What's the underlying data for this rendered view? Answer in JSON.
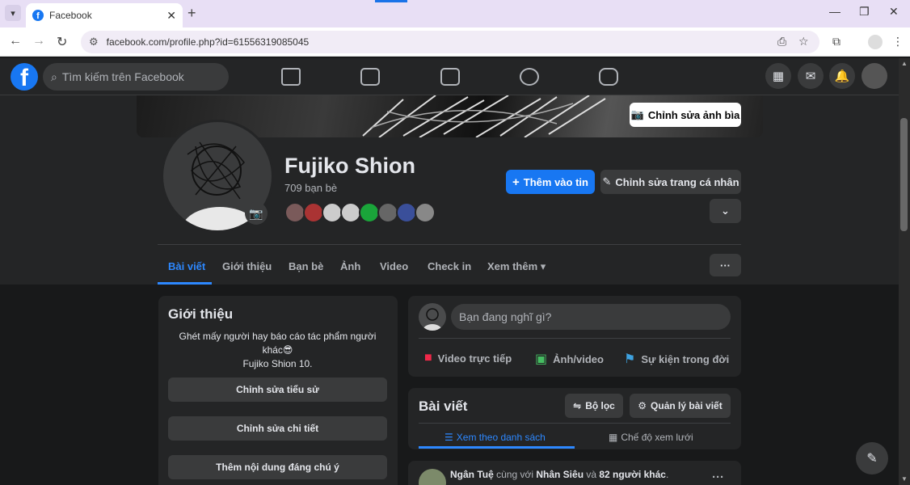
{
  "browser": {
    "tab_title": "Facebook",
    "url": "facebook.com/profile.php?id=61556319085045"
  },
  "fb": {
    "search_placeholder": "Tìm kiếm trên Facebook"
  },
  "profile": {
    "edit_cover_label": "Chỉnh sửa ảnh bìa",
    "name": "Fujiko Shion",
    "friends_count": "709 bạn bè",
    "add_story_label": "Thêm vào tin",
    "edit_profile_label": "Chỉnh sửa trang cá nhân",
    "tabs": [
      "Bài viết",
      "Giới thiệu",
      "Bạn bè",
      "Ảnh",
      "Video",
      "Check in",
      "Xem thêm"
    ]
  },
  "intro": {
    "title": "Giới thiệu",
    "bio_line1": "Ghét mấy người hay báo cáo tác phẩm người",
    "bio_line2": "khác😎",
    "bio_line3": "Fujiko Shion 10.",
    "edit_bio": "Chỉnh sửa tiểu sử",
    "edit_details": "Chỉnh sửa chi tiết",
    "add_featured": "Thêm nội dung đáng chú ý"
  },
  "composer": {
    "placeholder": "Bạn đang nghĩ gì?",
    "live": "Video trực tiếp",
    "photo": "Ảnh/video",
    "life_event": "Sự kiện trong đời"
  },
  "posts": {
    "title": "Bài viết",
    "filter": "Bộ lọc",
    "manage": "Quản lý bài viết",
    "list_view": "Xem theo danh sách",
    "grid_view": "Chế độ xem lưới",
    "author": "Ngân Tuệ",
    "with_text": " cùng với ",
    "tagged": "Nhân Siêu",
    "and_text": " và ",
    "others": "82 người khác",
    "dot": "."
  },
  "colors": {
    "accent": "#2d88ff",
    "primary_button": "#1877f2",
    "surface": "#242526",
    "background": "#18191a"
  }
}
